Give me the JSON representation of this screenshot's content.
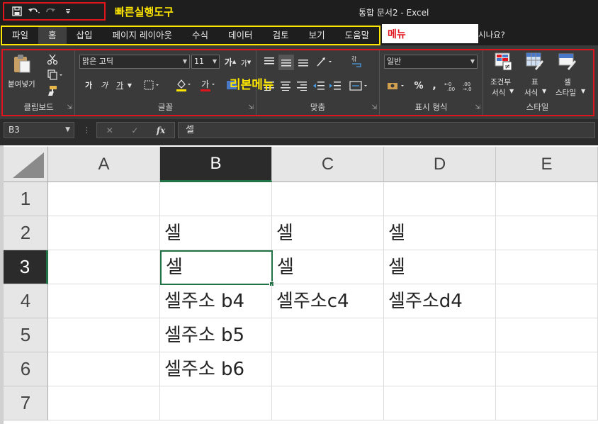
{
  "titlebar": {
    "qat_icons": [
      "save-icon",
      "undo-icon",
      "redo-icon",
      "customize-icon"
    ],
    "qat_annotation": "빠른실행도구",
    "title": "통합 문서2  -  Excel"
  },
  "menu": {
    "items": [
      "파일",
      "홈",
      "삽입",
      "페이지 레이아웃",
      "수식",
      "데이터",
      "검토",
      "보기",
      "도움말"
    ],
    "active": "홈",
    "annotation": "메뉴",
    "tell_me_tail": "시나요?"
  },
  "ribbon": {
    "annotation": "리본메뉴",
    "clipboard": {
      "paste_label": "붙여넣기",
      "group_label": "클립보드"
    },
    "font": {
      "font_name": "맑은 고딕",
      "font_size": "11",
      "group_label": "글꼴",
      "bold": "가",
      "italic": "가",
      "underline": "가"
    },
    "alignment": {
      "group_label": "맞춤"
    },
    "number": {
      "format": "일반",
      "group_label": "표시 형식"
    },
    "styles": {
      "conditional_label_1": "조건부",
      "conditional_label_2": "서식",
      "table_label_1": "표",
      "table_label_2": "서식",
      "cell_label_1": "셀",
      "cell_label_2": "스타일",
      "group_label": "스타일"
    }
  },
  "formula_bar": {
    "name_box": "B3",
    "fx": "fx",
    "value": "셀"
  },
  "sheet": {
    "columns": [
      "A",
      "B",
      "C",
      "D",
      "E"
    ],
    "active_column": "B",
    "rows": [
      "1",
      "2",
      "3",
      "4",
      "5",
      "6",
      "7"
    ],
    "active_row": "3",
    "cells": {
      "B2": "셀",
      "C2": "셀",
      "D2": "셀",
      "B3": "셀",
      "C3": "셀",
      "D3": "셀",
      "B4": "셀주소 b4",
      "C4": "셀주소c4",
      "D4": "셀주소d4",
      "B5": "셀주소 b5",
      "B6": "셀주소 b6"
    },
    "selected_cell": "B3"
  },
  "colors": {
    "annotation_red": "#e0141d",
    "annotation_yellow": "#ffe600",
    "excel_green": "#217346"
  }
}
